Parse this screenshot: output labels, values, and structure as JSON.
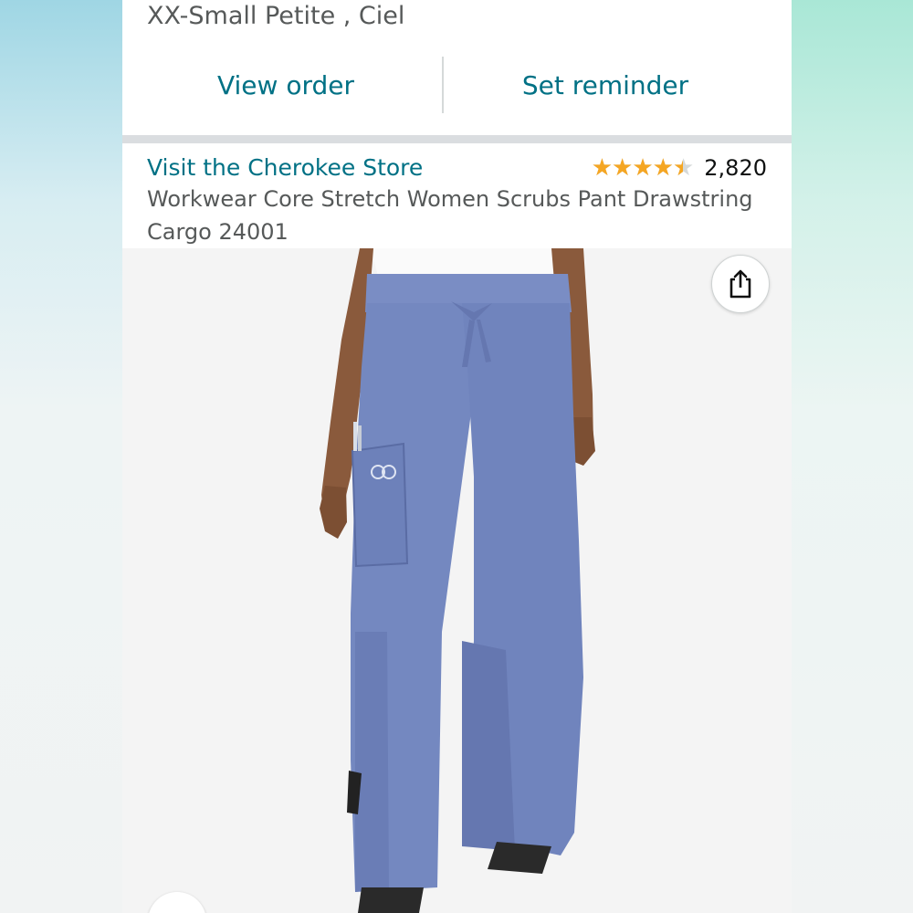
{
  "order": {
    "variant": "XX-Small Petite , Ciel",
    "view_order_label": "View order",
    "set_reminder_label": "Set reminder"
  },
  "product": {
    "store_link": "Visit the Cherokee Store",
    "rating": 4.5,
    "stars_glyphs": "★★★★★",
    "rating_count": "2,820",
    "title": "Workwear Core Stretch Women Scrubs Pant Drawstring Cargo 24001",
    "image_icon": "product-image",
    "share_icon": "share-icon"
  },
  "colors": {
    "link": "#007185",
    "star": "#f5a623",
    "text_secondary": "#565959",
    "pants": "#7488c0"
  }
}
